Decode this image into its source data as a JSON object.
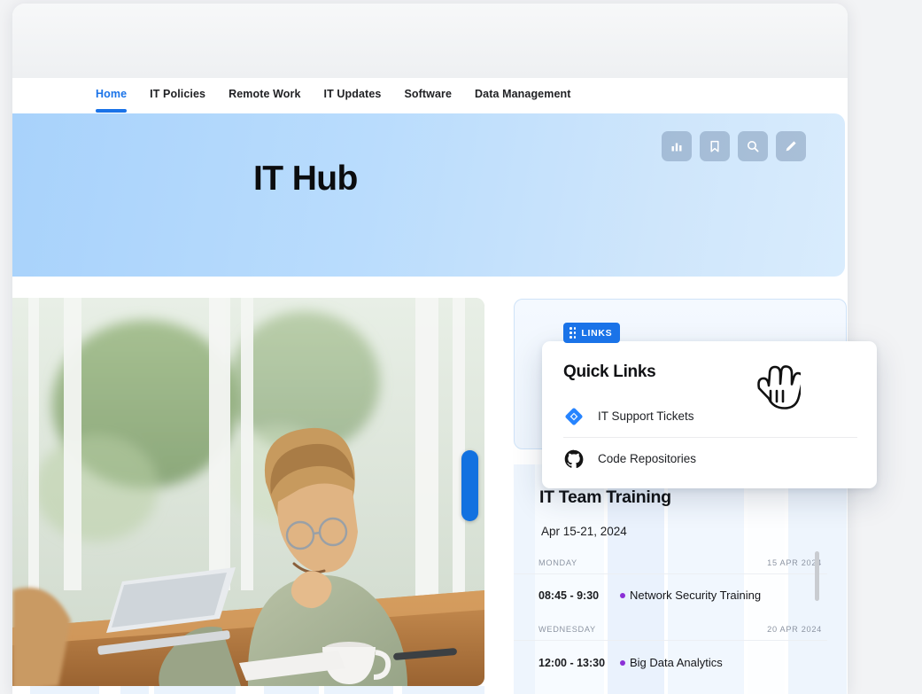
{
  "nav": {
    "items": [
      {
        "label": "Home",
        "active": true
      },
      {
        "label": "IT Policies",
        "active": false
      },
      {
        "label": "Remote Work",
        "active": false
      },
      {
        "label": "IT Updates",
        "active": false
      },
      {
        "label": "Software",
        "active": false
      },
      {
        "label": "Data Management",
        "active": false
      }
    ]
  },
  "hero": {
    "title": "IT Hub",
    "tools": [
      {
        "icon": "bar-chart-icon",
        "name": "analytics-button"
      },
      {
        "icon": "bookmark-icon",
        "name": "bookmark-button"
      },
      {
        "icon": "search-icon",
        "name": "search-button"
      },
      {
        "icon": "pencil-icon",
        "name": "edit-button"
      }
    ]
  },
  "quick_links_card": {
    "badge_label": "LINKS",
    "title": "Quick Links",
    "items": [
      {
        "label": "IT Support Tickets",
        "icon": "jira-diamond-icon"
      },
      {
        "label": "Code Repositories",
        "icon": "github-icon"
      }
    ]
  },
  "schedule": {
    "title": "IT Team Training",
    "range": "Apr 15-21, 2024",
    "days": [
      {
        "name": "MONDAY",
        "date": "15 APR 2024",
        "events": [
          {
            "time": "08:45 - 9:30",
            "title": "Network Security Training"
          }
        ]
      },
      {
        "name": "WEDNESDAY",
        "date": "20 APR 2024",
        "events": [
          {
            "time": "12:00 - 13:30",
            "title": "Big Data Analytics"
          }
        ]
      }
    ]
  },
  "colors": {
    "accent_blue": "#1a73e8",
    "hero_gradient_start": "#a8d2fb",
    "hero_gradient_end": "#d9ecfd",
    "event_dot": "#8b2fd6",
    "page_background": "#f2f3f5"
  }
}
